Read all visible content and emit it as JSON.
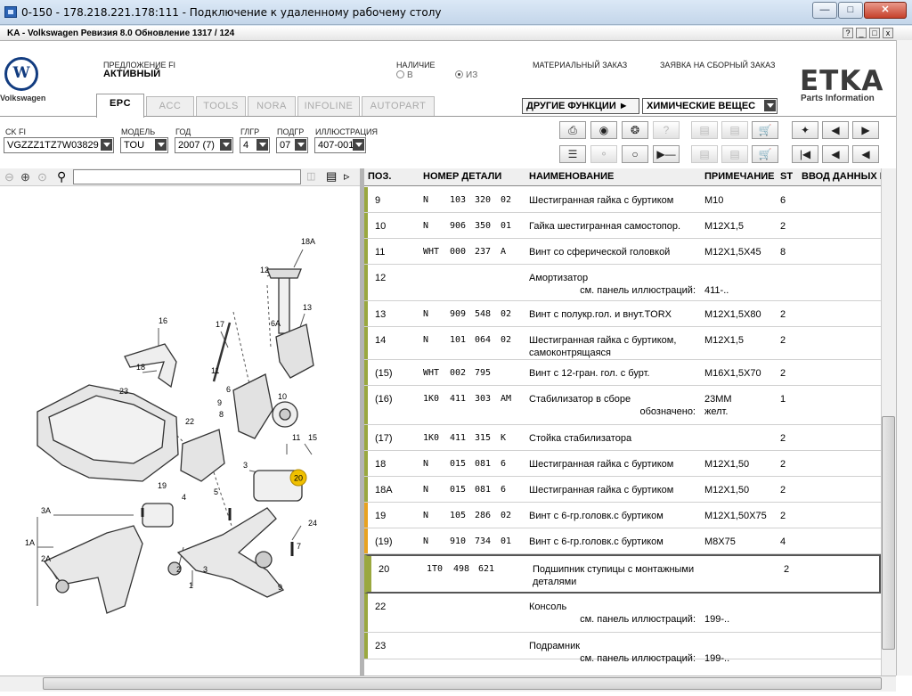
{
  "window": {
    "title": "0-150 - 178.218.221.178:111 - Подключение к удаленному рабочему столу"
  },
  "app": {
    "title": "KA - Volkswagen Ревизия 8.0 Обновление 1317 / 124"
  },
  "header": {
    "brand_name": "Volkswagen",
    "offer_label": "ПРЕДЛОЖЕНИЕ FI",
    "offer_value": "АКТИВНЫЙ",
    "stock_label": "НАЛИЧИЕ",
    "stock_opt_b": "В",
    "stock_opt_iz": "ИЗ",
    "material_order": "МАТЕРИАЛЬНЫЙ ЗАКАЗ",
    "assembly_order": "ЗАЯВКА НА СБОРНЫЙ ЗАКАЗ",
    "logo": "ETKA",
    "logo_sub": "Parts Information"
  },
  "tabs": [
    "EPC",
    "ACC",
    "TOOLS",
    "NORA",
    "INFOLINE",
    "AUTOPART"
  ],
  "functions": {
    "other_label": "ДРУГИЕ ФУНКЦИИ",
    "chem_value": "ХИМИЧЕСКИЕ ВЕЩЕС"
  },
  "selectors": {
    "vin": {
      "label": "CK FI",
      "value": "VGZZZ1TZ7W03829"
    },
    "model": {
      "label": "МОДЕЛЬ",
      "value": "TOU"
    },
    "year": {
      "label": "ГОД",
      "value": "2007 (7)"
    },
    "glgr": {
      "label": "ГЛГР",
      "value": "4"
    },
    "podgr": {
      "label": "ПОДГР",
      "value": "07"
    },
    "illustration": {
      "label": "ИЛЛЮСТРАЦИЯ",
      "value": "407-001"
    }
  },
  "columns": [
    "ПОЗ.",
    "НОМЕР ДЕТАЛИ",
    "НАИМЕНОВАНИЕ",
    "ПРИМЕЧАНИЕ",
    "ST",
    "ВВОД ДАННЫХ П"
  ],
  "rows": [
    {
      "pos": "9",
      "p1": "N",
      "p2": "103",
      "p3": "320",
      "p4": "02",
      "name": "Шестигранная гайка с буртиком",
      "name2": "",
      "note": "M10",
      "note2": "",
      "st": "6",
      "bar": "green"
    },
    {
      "pos": "10",
      "p1": "N",
      "p2": "906",
      "p3": "350",
      "p4": "01",
      "name": "Гайка шестигранная самостопор.",
      "name2": "",
      "note": "M12X1,5",
      "note2": "",
      "st": "2",
      "bar": "green"
    },
    {
      "pos": "11",
      "p1": "WHT",
      "p2": "000",
      "p3": "237",
      "p4": "A",
      "name": "Винт со сферической головкой",
      "name2": "",
      "note": "M12X1,5X45",
      "note2": "",
      "st": "8",
      "bar": "green"
    },
    {
      "pos": "12",
      "p1": "",
      "p2": "",
      "p3": "",
      "p4": "",
      "name": "Амортизатор",
      "name2": "см. панель иллюстраций:",
      "note": "",
      "note2": "411-..",
      "st": "",
      "bar": "green"
    },
    {
      "pos": "13",
      "p1": "N",
      "p2": "909",
      "p3": "548",
      "p4": "02",
      "name": "Винт с полукр.гол. и внут.TORX",
      "name2": "",
      "note": "M12X1,5X80",
      "note2": "",
      "st": "2",
      "bar": "green"
    },
    {
      "pos": "14",
      "p1": "N",
      "p2": "101",
      "p3": "064",
      "p4": "02",
      "name": "Шестигранная гайка с буртиком,",
      "name2": "самоконтрящаяся",
      "note": "M12X1,5",
      "note2": "",
      "st": "2",
      "bar": "green"
    },
    {
      "pos": "(15)",
      "p1": "WHT",
      "p2": "002",
      "p3": "795",
      "p4": "",
      "name": "Винт с 12-гран. гол. с бурт.",
      "name2": "",
      "note": "M16X1,5X70",
      "note2": "",
      "st": "2",
      "bar": "green"
    },
    {
      "pos": "(16)",
      "p1": "1K0",
      "p2": "411",
      "p3": "303",
      "p4": "AM",
      "name": "Стабилизатор в сборе",
      "name2": "обозначено:",
      "note": "23MM",
      "note2": "желт.",
      "st": "1",
      "bar": "green"
    },
    {
      "pos": "(17)",
      "p1": "1K0",
      "p2": "411",
      "p3": "315",
      "p4": "K",
      "name": "Стойка стабилизатора",
      "name2": "",
      "note": "",
      "note2": "",
      "st": "2",
      "bar": "green"
    },
    {
      "pos": "18",
      "p1": "N",
      "p2": "015",
      "p3": "081",
      "p4": "6",
      "name": "Шестигранная гайка с буртиком",
      "name2": "",
      "note": "M12X1,50",
      "note2": "",
      "st": "2",
      "bar": "green"
    },
    {
      "pos": "18A",
      "p1": "N",
      "p2": "015",
      "p3": "081",
      "p4": "6",
      "name": "Шестигранная гайка с буртиком",
      "name2": "",
      "note": "M12X1,50",
      "note2": "",
      "st": "2",
      "bar": "green"
    },
    {
      "pos": "19",
      "p1": "N",
      "p2": "105",
      "p3": "286",
      "p4": "02",
      "name": "Винт с 6-гр.головк.с буртиком",
      "name2": "",
      "note": "M12X1,50X75",
      "note2": "",
      "st": "2",
      "bar": "orange"
    },
    {
      "pos": "(19)",
      "p1": "N",
      "p2": "910",
      "p3": "734",
      "p4": "01",
      "name": "Винт с 6-гр.головк.с буртиком",
      "name2": "",
      "note": "M8X75",
      "note2": "",
      "st": "4",
      "bar": "orange"
    },
    {
      "pos": "20",
      "p1": "1T0",
      "p2": "498",
      "p3": "621",
      "p4": "",
      "name": "Подшипник ступицы с монтажными",
      "name2": "деталями",
      "note": "",
      "note2": "",
      "st": "2",
      "bar": "green"
    },
    {
      "pos": "22",
      "p1": "",
      "p2": "",
      "p3": "",
      "p4": "",
      "name": "Консоль",
      "name2": "см. панель иллюстраций:",
      "note": "",
      "note2": "199-..",
      "st": "",
      "bar": "green"
    },
    {
      "pos": "23",
      "p1": "",
      "p2": "",
      "p3": "",
      "p4": "",
      "name": "Подрамник",
      "name2": "см. панель иллюстраций:",
      "note": "",
      "note2": "199-..",
      "st": "",
      "bar": "green"
    }
  ],
  "diagram": {
    "callouts": [
      "18A",
      "12",
      "13",
      "16",
      "17",
      "6A",
      "18",
      "11",
      "6",
      "9",
      "8",
      "23",
      "22",
      "10",
      "11",
      "15",
      "20",
      "3",
      "19",
      "4",
      "5",
      "3A",
      "24",
      "7",
      "1A",
      "2A",
      "2",
      "3",
      "1",
      "9"
    ],
    "highlight": "20"
  },
  "colors": {
    "bar_green": "#9aa83f",
    "bar_orange": "#e8a220",
    "highlight": "#f0c000"
  }
}
